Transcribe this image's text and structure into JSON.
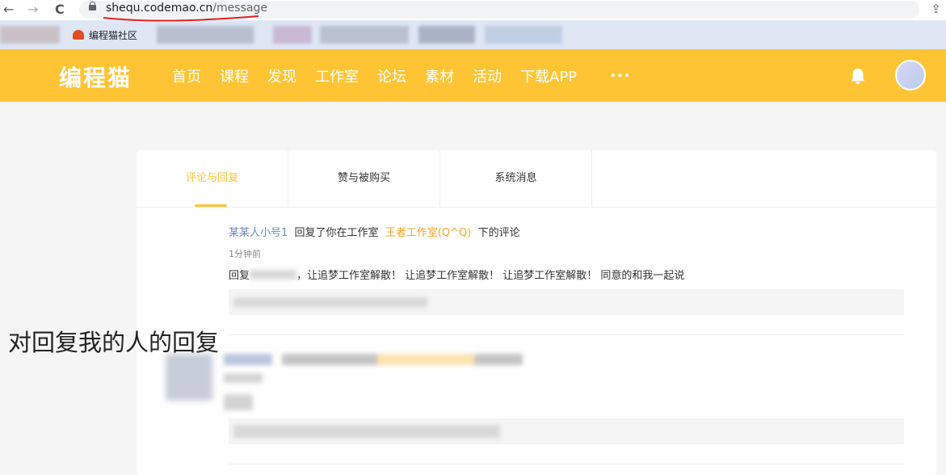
{
  "browser": {
    "back_icon": "←",
    "forward_icon": "→",
    "reload_icon": "C",
    "url_domain": "shequ.codemao.cn",
    "url_path": "/message",
    "bookmark_label": "编程猫社区"
  },
  "header": {
    "logo": "编程猫",
    "nav": [
      "首页",
      "课程",
      "发现",
      "工作室",
      "论坛",
      "素材",
      "活动",
      "下载APP"
    ],
    "more": "···",
    "accent": "#fec433"
  },
  "tabs": [
    "评论与回复",
    "赞与被购买",
    "系统消息"
  ],
  "message": {
    "user": "某某人小号1",
    "action": "回复了你在工作室",
    "studio": "王者工作室(Q^Q)",
    "suffix": "下的评论",
    "time": "1分钟前",
    "reply_prefix": "回复",
    "reply_text": "，让追梦工作室解散！ 让追梦工作室解散！ 让追梦工作室解散！ 同意的和我一起说"
  },
  "annotation": "对回复我的人的回复"
}
